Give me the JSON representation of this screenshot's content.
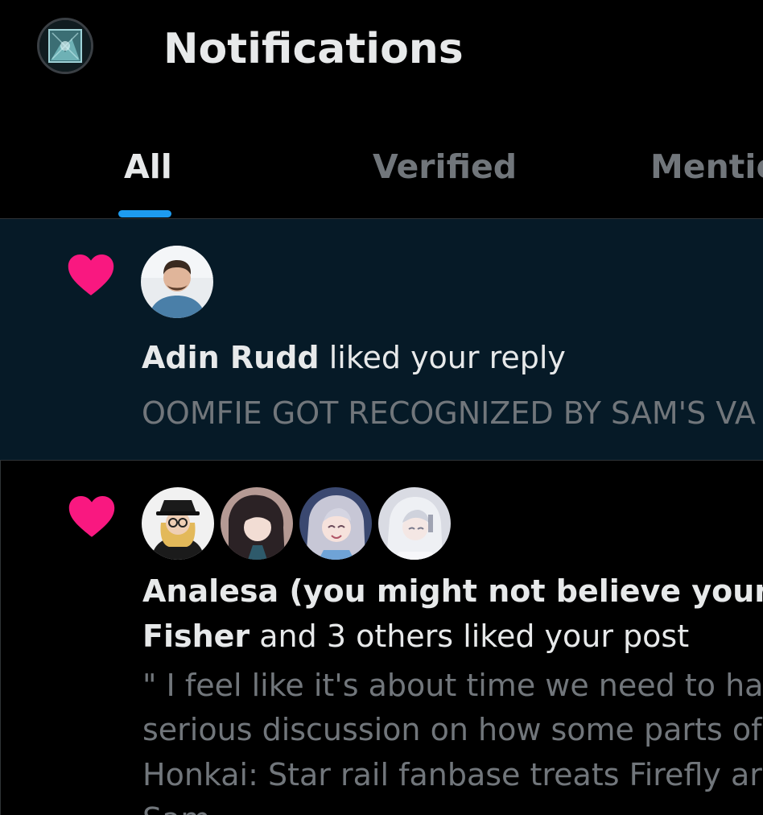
{
  "header": {
    "title": "Notifications",
    "profile_avatar_icon": "profile-avatar-icon"
  },
  "tabs": [
    {
      "label": "All",
      "active": true
    },
    {
      "label": "Verified",
      "active": false
    },
    {
      "label": "Mentio",
      "active": false
    }
  ],
  "colors": {
    "accent": "#1d9bf0",
    "like": "#f91880",
    "unread_background": "#061a27"
  },
  "notifications": [
    {
      "icon": "heart-icon",
      "actor": "Adin Rudd",
      "action": " liked your reply",
      "preview_lines": [
        "OOMFIE GOT RECOGNIZED BY SAM'S VA"
      ]
    },
    {
      "icon": "heart-icon",
      "actor_line1": "Analesa (you might not believe your ey",
      "actor_line2": "Fisher",
      "action": " and 3 others liked your post",
      "preview_lines": [
        "\" I feel like it's about time we need to hav",
        "serious discussion on how some parts of",
        "Honkai: Star rail fanbase treats Firefly ar",
        "Sam"
      ]
    }
  ]
}
